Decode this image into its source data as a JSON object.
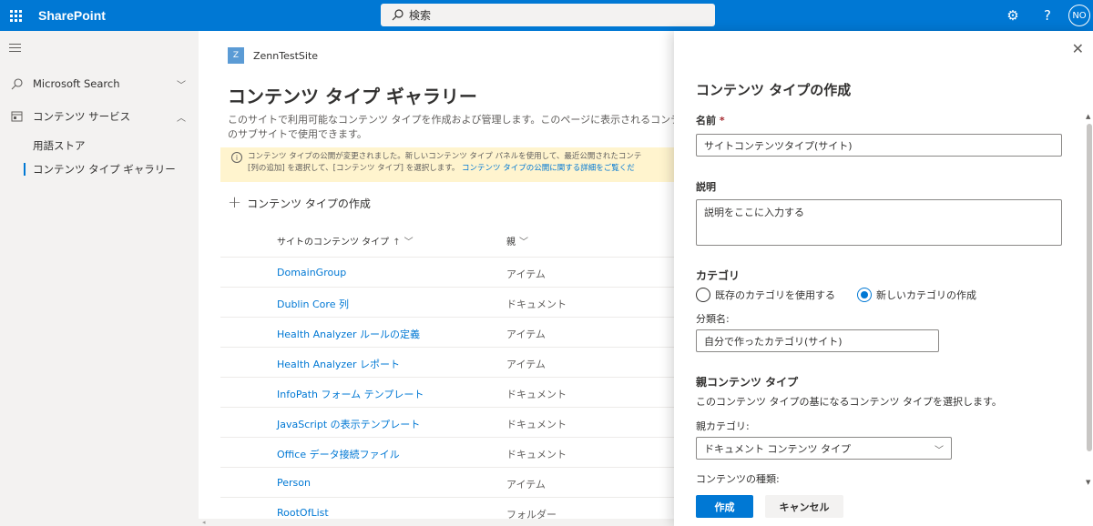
{
  "suite": {
    "brand": "SharePoint",
    "search_placeholder": "検索",
    "avatar_initials": "NO"
  },
  "leftnav": {
    "items": [
      {
        "label": "Microsoft Search",
        "icon": "search-icon",
        "chevron": "chevron-down-icon"
      },
      {
        "label": "コンテンツ サービス",
        "icon": "content-services-icon",
        "chevron": "chevron-up-icon"
      }
    ],
    "subitems": [
      {
        "label": "用語ストア"
      },
      {
        "label": "コンテンツ タイプ ギャラリー"
      }
    ]
  },
  "main": {
    "site_logo_letter": "Z",
    "site_name": "ZennTestSite",
    "title": "コンテンツ タイプ ギャラリー",
    "desc_line1": "このサイトで利用可能なコンテンツ タイプを作成および管理します。このページに表示されるコンテ",
    "desc_line2": "のサブサイトで使用できます。",
    "notice_line1": "コンテンツ タイプの公開が変更されました。新しいコンテンツ タイプ パネルを使用して、最近公開されたコンテ",
    "notice_line2": "[列の追加] を選択して、[コンテンツ タイプ] を選択します。",
    "notice_link": "コンテンツ タイプの公開に関する詳細をご覧くだ",
    "create_label": "コンテンツ タイプの作成",
    "col_name": "サイトのコンテンツ タイプ",
    "col_parent": "親",
    "rows": [
      {
        "name": "DomainGroup",
        "parent": "アイテム"
      },
      {
        "name": "Dublin Core 列",
        "parent": "ドキュメント"
      },
      {
        "name": "Health Analyzer ルールの定義",
        "parent": "アイテム"
      },
      {
        "name": "Health Analyzer レポート",
        "parent": "アイテム"
      },
      {
        "name": "InfoPath フォーム テンプレート",
        "parent": "ドキュメント"
      },
      {
        "name": "JavaScript の表示テンプレート",
        "parent": "ドキュメント"
      },
      {
        "name": "Office データ接続ファイル",
        "parent": "ドキュメント"
      },
      {
        "name": "Person",
        "parent": "アイテム"
      },
      {
        "name": "RootOfList",
        "parent": "フォルダー"
      }
    ]
  },
  "panel": {
    "title": "コンテンツ タイプの作成",
    "name_label": "名前",
    "required_mark": "*",
    "name_value": "サイトコンテンツタイプ(サイト)",
    "desc_label": "説明",
    "desc_value": "説明をここに入力する",
    "category_label": "カテゴリ",
    "radio_existing": "既存のカテゴリを使用する",
    "radio_new": "新しいカテゴリの作成",
    "class_label": "分類名:",
    "class_value": "自分で作ったカテゴリ(サイト)",
    "parent_section": "親コンテンツ タイプ",
    "parent_desc": "このコンテンツ タイプの基になるコンテンツ タイプを選択します。",
    "parent_cat_label": "親カテゴリ:",
    "parent_cat_value": "ドキュメント コンテンツ タイプ",
    "content_kind_label": "コンテンツの種類:",
    "create_button": "作成",
    "cancel_button": "キャンセル"
  }
}
